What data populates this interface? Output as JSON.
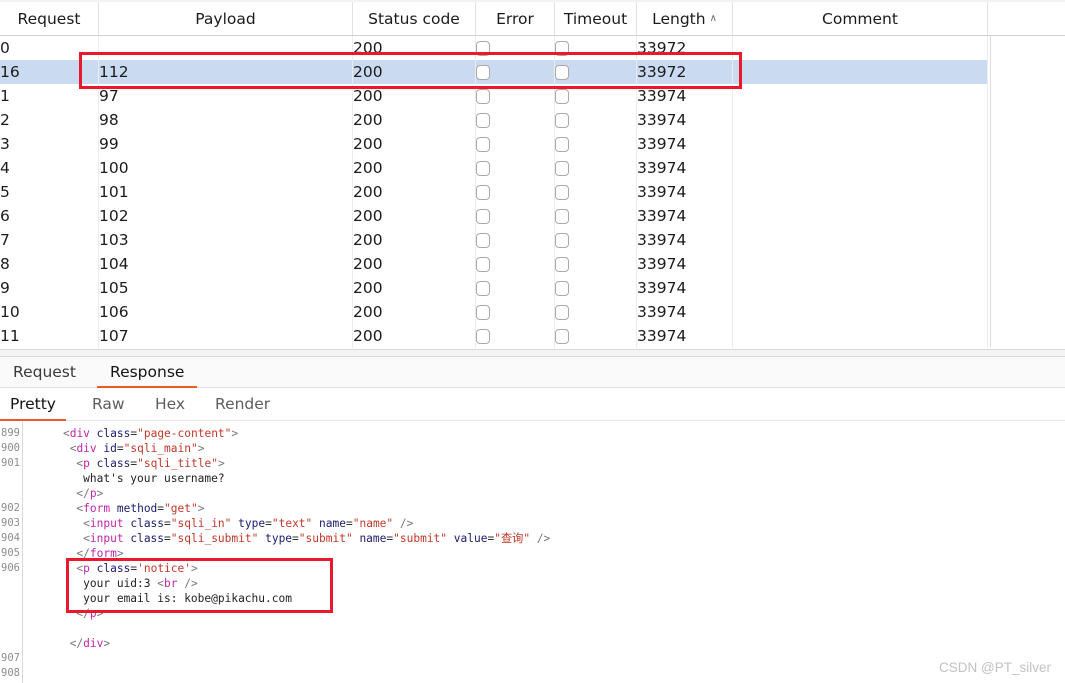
{
  "results_table": {
    "columns": [
      {
        "key": "request",
        "label": "Request",
        "sorted": false
      },
      {
        "key": "payload",
        "label": "Payload",
        "sorted": false
      },
      {
        "key": "status_code",
        "label": "Status code",
        "sorted": false
      },
      {
        "key": "error",
        "label": "Error",
        "sorted": false
      },
      {
        "key": "timeout",
        "label": "Timeout",
        "sorted": false
      },
      {
        "key": "length",
        "label": "Length",
        "sorted": true,
        "sort_caret": "∧"
      },
      {
        "key": "comment",
        "label": "Comment",
        "sorted": false
      }
    ],
    "rows": [
      {
        "request": "0",
        "payload": "",
        "status_code": "200",
        "error": false,
        "timeout": false,
        "length": "33972",
        "comment": "",
        "selected": false
      },
      {
        "request": "16",
        "payload": "112",
        "status_code": "200",
        "error": false,
        "timeout": false,
        "length": "33972",
        "comment": "",
        "selected": true
      },
      {
        "request": "1",
        "payload": "97",
        "status_code": "200",
        "error": false,
        "timeout": false,
        "length": "33974",
        "comment": "",
        "selected": false
      },
      {
        "request": "2",
        "payload": "98",
        "status_code": "200",
        "error": false,
        "timeout": false,
        "length": "33974",
        "comment": "",
        "selected": false
      },
      {
        "request": "3",
        "payload": "99",
        "status_code": "200",
        "error": false,
        "timeout": false,
        "length": "33974",
        "comment": "",
        "selected": false
      },
      {
        "request": "4",
        "payload": "100",
        "status_code": "200",
        "error": false,
        "timeout": false,
        "length": "33974",
        "comment": "",
        "selected": false
      },
      {
        "request": "5",
        "payload": "101",
        "status_code": "200",
        "error": false,
        "timeout": false,
        "length": "33974",
        "comment": "",
        "selected": false
      },
      {
        "request": "6",
        "payload": "102",
        "status_code": "200",
        "error": false,
        "timeout": false,
        "length": "33974",
        "comment": "",
        "selected": false
      },
      {
        "request": "7",
        "payload": "103",
        "status_code": "200",
        "error": false,
        "timeout": false,
        "length": "33974",
        "comment": "",
        "selected": false
      },
      {
        "request": "8",
        "payload": "104",
        "status_code": "200",
        "error": false,
        "timeout": false,
        "length": "33974",
        "comment": "",
        "selected": false
      },
      {
        "request": "9",
        "payload": "105",
        "status_code": "200",
        "error": false,
        "timeout": false,
        "length": "33974",
        "comment": "",
        "selected": false
      },
      {
        "request": "10",
        "payload": "106",
        "status_code": "200",
        "error": false,
        "timeout": false,
        "length": "33974",
        "comment": "",
        "selected": false
      },
      {
        "request": "11",
        "payload": "107",
        "status_code": "200",
        "error": false,
        "timeout": false,
        "length": "33974",
        "comment": "",
        "selected": false
      }
    ]
  },
  "message_tabs": {
    "items": [
      {
        "label": "Request",
        "active": false
      },
      {
        "label": "Response",
        "active": true
      }
    ],
    "active_label": "Response"
  },
  "view_tabs": {
    "items": [
      {
        "label": "Pretty",
        "active": true
      },
      {
        "label": "Raw",
        "active": false
      },
      {
        "label": "Hex",
        "active": false
      },
      {
        "label": "Render",
        "active": false
      }
    ],
    "active_label": "Pretty"
  },
  "code_viewer": {
    "line_numbers": [
      "899",
      "900",
      "901",
      "902",
      "903",
      "904",
      "905",
      "906",
      "907",
      "908"
    ],
    "lines": [
      {
        "num": "899",
        "indent": 4,
        "tokens": [
          {
            "t": "pn",
            "s": "<"
          },
          {
            "t": "tg",
            "s": "div"
          },
          {
            "t": "tx",
            "s": " "
          },
          {
            "t": "at",
            "s": "class"
          },
          {
            "t": "eq",
            "s": "="
          },
          {
            "t": "vl",
            "s": "\"page-content\""
          },
          {
            "t": "pn",
            "s": ">"
          }
        ]
      },
      {
        "num": "900",
        "indent": 5,
        "tokens": [
          {
            "t": "pn",
            "s": "<"
          },
          {
            "t": "tg",
            "s": "div"
          },
          {
            "t": "tx",
            "s": " "
          },
          {
            "t": "at",
            "s": "id"
          },
          {
            "t": "eq",
            "s": "="
          },
          {
            "t": "vl",
            "s": "\"sqli_main\""
          },
          {
            "t": "pn",
            "s": ">"
          }
        ]
      },
      {
        "num": "901",
        "indent": 6,
        "tokens": [
          {
            "t": "pn",
            "s": "<"
          },
          {
            "t": "tg",
            "s": "p"
          },
          {
            "t": "tx",
            "s": " "
          },
          {
            "t": "at",
            "s": "class"
          },
          {
            "t": "eq",
            "s": "="
          },
          {
            "t": "vl",
            "s": "\"sqli_title\""
          },
          {
            "t": "pn",
            "s": ">"
          }
        ]
      },
      {
        "num": "",
        "indent": 7,
        "tokens": [
          {
            "t": "tx",
            "s": "what's your username?"
          }
        ]
      },
      {
        "num": "",
        "indent": 6,
        "tokens": [
          {
            "t": "pn",
            "s": "</"
          },
          {
            "t": "tg",
            "s": "p"
          },
          {
            "t": "pn",
            "s": ">"
          }
        ]
      },
      {
        "num": "902",
        "indent": 6,
        "tokens": [
          {
            "t": "pn",
            "s": "<"
          },
          {
            "t": "tg",
            "s": "form"
          },
          {
            "t": "tx",
            "s": " "
          },
          {
            "t": "at",
            "s": "method"
          },
          {
            "t": "eq",
            "s": "="
          },
          {
            "t": "vl",
            "s": "\"get\""
          },
          {
            "t": "pn",
            "s": ">"
          }
        ]
      },
      {
        "num": "903",
        "indent": 7,
        "tokens": [
          {
            "t": "pn",
            "s": "<"
          },
          {
            "t": "tg",
            "s": "input"
          },
          {
            "t": "tx",
            "s": " "
          },
          {
            "t": "at",
            "s": "class"
          },
          {
            "t": "eq",
            "s": "="
          },
          {
            "t": "vl",
            "s": "\"sqli_in\""
          },
          {
            "t": "tx",
            "s": " "
          },
          {
            "t": "at",
            "s": "type"
          },
          {
            "t": "eq",
            "s": "="
          },
          {
            "t": "vl",
            "s": "\"text\""
          },
          {
            "t": "tx",
            "s": " "
          },
          {
            "t": "at",
            "s": "name"
          },
          {
            "t": "eq",
            "s": "="
          },
          {
            "t": "vl",
            "s": "\"name\""
          },
          {
            "t": "pn",
            "s": " />"
          }
        ]
      },
      {
        "num": "904",
        "indent": 7,
        "tokens": [
          {
            "t": "pn",
            "s": "<"
          },
          {
            "t": "tg",
            "s": "input"
          },
          {
            "t": "tx",
            "s": " "
          },
          {
            "t": "at",
            "s": "class"
          },
          {
            "t": "eq",
            "s": "="
          },
          {
            "t": "vl",
            "s": "\"sqli_submit\""
          },
          {
            "t": "tx",
            "s": " "
          },
          {
            "t": "at",
            "s": "type"
          },
          {
            "t": "eq",
            "s": "="
          },
          {
            "t": "vl",
            "s": "\"submit\""
          },
          {
            "t": "tx",
            "s": " "
          },
          {
            "t": "at",
            "s": "name"
          },
          {
            "t": "eq",
            "s": "="
          },
          {
            "t": "vl",
            "s": "\"submit\""
          },
          {
            "t": "tx",
            "s": " "
          },
          {
            "t": "at",
            "s": "value"
          },
          {
            "t": "eq",
            "s": "="
          },
          {
            "t": "vl",
            "s": "\"查询\""
          },
          {
            "t": "pn",
            "s": " />"
          }
        ]
      },
      {
        "num": "905",
        "indent": 6,
        "tokens": [
          {
            "t": "pn",
            "s": "</"
          },
          {
            "t": "tg",
            "s": "form"
          },
          {
            "t": "pn",
            "s": ">"
          }
        ]
      },
      {
        "num": "906",
        "indent": 6,
        "tokens": [
          {
            "t": "pn",
            "s": "<"
          },
          {
            "t": "tg",
            "s": "p"
          },
          {
            "t": "tx",
            "s": " "
          },
          {
            "t": "at",
            "s": "class"
          },
          {
            "t": "eq",
            "s": "="
          },
          {
            "t": "vl",
            "s": "'notice'"
          },
          {
            "t": "pn",
            "s": ">"
          }
        ]
      },
      {
        "num": "",
        "indent": 7,
        "tokens": [
          {
            "t": "tx",
            "s": "your uid:3 "
          },
          {
            "t": "pn",
            "s": "<"
          },
          {
            "t": "tg",
            "s": "br"
          },
          {
            "t": "pn",
            "s": " />"
          }
        ]
      },
      {
        "num": "",
        "indent": 7,
        "tokens": [
          {
            "t": "tx",
            "s": "your email is: kobe@pikachu.com"
          }
        ]
      },
      {
        "num": "",
        "indent": 6,
        "tokens": [
          {
            "t": "pn",
            "s": "</"
          },
          {
            "t": "tg",
            "s": "p"
          },
          {
            "t": "pn",
            "s": ">"
          }
        ]
      },
      {
        "num": "",
        "indent": 0,
        "tokens": [
          {
            "t": "tx",
            "s": ""
          }
        ]
      },
      {
        "num": "",
        "indent": 5,
        "tokens": [
          {
            "t": "pn",
            "s": "</"
          },
          {
            "t": "tg",
            "s": "div"
          },
          {
            "t": "pn",
            "s": ">"
          }
        ]
      },
      {
        "num": "907",
        "indent": 0,
        "tokens": [
          {
            "t": "tx",
            "s": ""
          }
        ]
      },
      {
        "num": "908",
        "indent": 0,
        "tokens": [
          {
            "t": "tx",
            "s": ""
          }
        ]
      }
    ]
  },
  "annotations": [
    {
      "name": "selected-row-highlight",
      "color": "#e8192c"
    },
    {
      "name": "notice-block-highlight",
      "color": "#e8192c"
    }
  ],
  "watermark": {
    "text": "CSDN @PT_silver"
  },
  "colors": {
    "selection": "#c9daf1",
    "accent_tab": "#ea5b28",
    "annotation": "#e8192c",
    "tag": "#c026a8",
    "attr_value": "#c0392b",
    "attr_name": "#1a1a6e"
  }
}
